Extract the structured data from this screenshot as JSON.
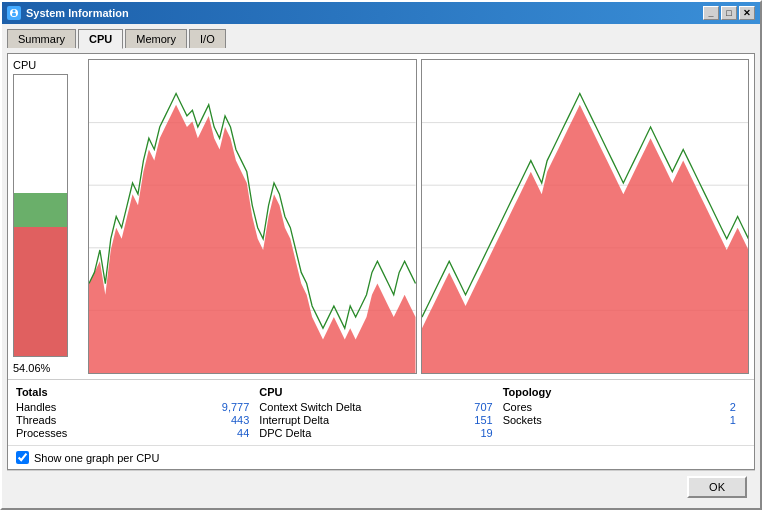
{
  "window": {
    "title": "System Information",
    "minimize_label": "_",
    "maximize_label": "□",
    "close_label": "✕"
  },
  "tabs": [
    {
      "label": "Summary",
      "active": false
    },
    {
      "label": "CPU",
      "active": true
    },
    {
      "label": "Memory",
      "active": false
    },
    {
      "label": "I/O",
      "active": false
    }
  ],
  "cpu": {
    "label": "CPU",
    "percent": "54.06%"
  },
  "totals": {
    "title": "Totals",
    "rows": [
      {
        "label": "Handles",
        "value": "9,777"
      },
      {
        "label": "Threads",
        "value": "443"
      },
      {
        "label": "Processes",
        "value": "44"
      }
    ]
  },
  "cpu_stats": {
    "title": "CPU",
    "rows": [
      {
        "label": "Context Switch Delta",
        "value": "707"
      },
      {
        "label": "Interrupt Delta",
        "value": "151"
      },
      {
        "label": "DPC Delta",
        "value": "19"
      }
    ]
  },
  "topology": {
    "title": "Topology",
    "rows": [
      {
        "label": "Cores",
        "value": "2"
      },
      {
        "label": "Sockets",
        "value": "1"
      }
    ]
  },
  "checkbox": {
    "label": "Show one graph per CPU",
    "checked": true
  },
  "ok_button": "OK"
}
